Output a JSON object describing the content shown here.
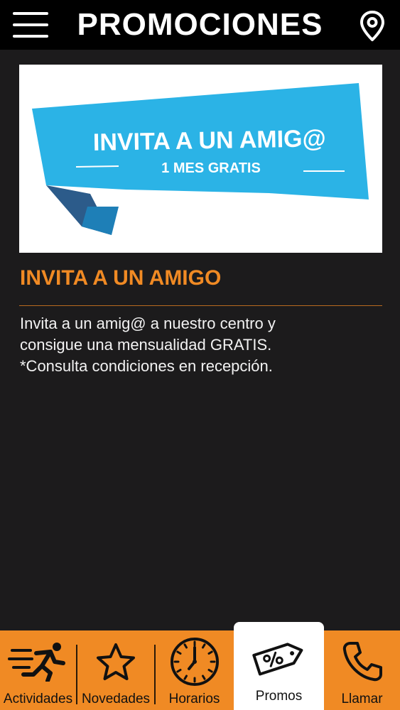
{
  "header": {
    "title": "PROMOCIONES",
    "menu_icon": "hamburger-menu-icon",
    "location_icon": "map-pin-icon"
  },
  "promo": {
    "banner": {
      "line1": "INVITA A UN AMIG@",
      "line2": "1 MES GRATIS",
      "ribbon_color": "#2bb3e6",
      "ribbon_shadow_color": "#2c5b8a"
    },
    "title": "INVITA A UN AMIGO",
    "description": "Invita  a un amig@ a nuestro centro y\nconsigue una mensualidad GRATIS.\n*Consulta condiciones en recepción."
  },
  "colors": {
    "accent": "#f08a24",
    "background": "#1c1b1c",
    "topbar": "#000000"
  },
  "bottom_nav": {
    "items": [
      {
        "label": "Actividades",
        "icon": "runner-icon",
        "active": false
      },
      {
        "label": "Novedades",
        "icon": "star-icon",
        "active": false
      },
      {
        "label": "Horarios",
        "icon": "clock-icon",
        "active": false
      },
      {
        "label": "Promos",
        "icon": "percent-tag-icon",
        "active": true
      },
      {
        "label": "Llamar",
        "icon": "phone-icon",
        "active": false
      }
    ]
  }
}
